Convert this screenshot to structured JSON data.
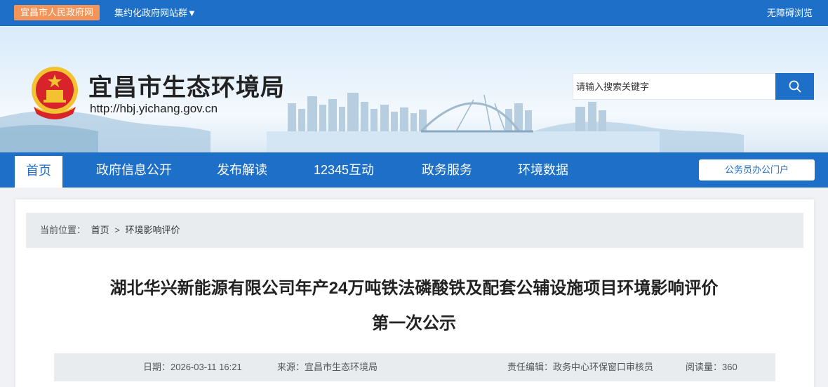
{
  "topbar": {
    "gov_link": "宜昌市人民政府网",
    "site_group": "集约化政府网站群▼",
    "accessible": "无障碍浏览"
  },
  "header": {
    "title": "宜昌市生态环境局",
    "url": "http://hbj.yichang.gov.cn",
    "search_placeholder": "请输入搜索关键字"
  },
  "nav": {
    "items": [
      "首页",
      "政府信息公开",
      "发布解读",
      "12345互动",
      "政务服务",
      "环境数据"
    ],
    "active_index": 0,
    "portal_button": "公务员办公门户"
  },
  "breadcrumb": {
    "prefix": "当前位置：",
    "home": "首页",
    "separator": ">",
    "current": "环境影响评价"
  },
  "article": {
    "title_line1": "湖北华兴新能源有限公司年产24万吨铁法磷酸铁及配套公辅设施项目环境影响评价",
    "title_line2": "第一次公示",
    "date": "日期：2026-03-11 16:21",
    "source": "来源：宜昌市生态环境局",
    "editor": "责任编辑：政务中心环保窗口审核员",
    "reads": "阅读量：360"
  },
  "colors": {
    "brand_blue": "#1d6fc8",
    "gov_orange": "#f3955a",
    "panel_gray": "#e9ecef"
  },
  "icons": {
    "search": "search-icon",
    "emblem": "national-emblem-icon"
  }
}
